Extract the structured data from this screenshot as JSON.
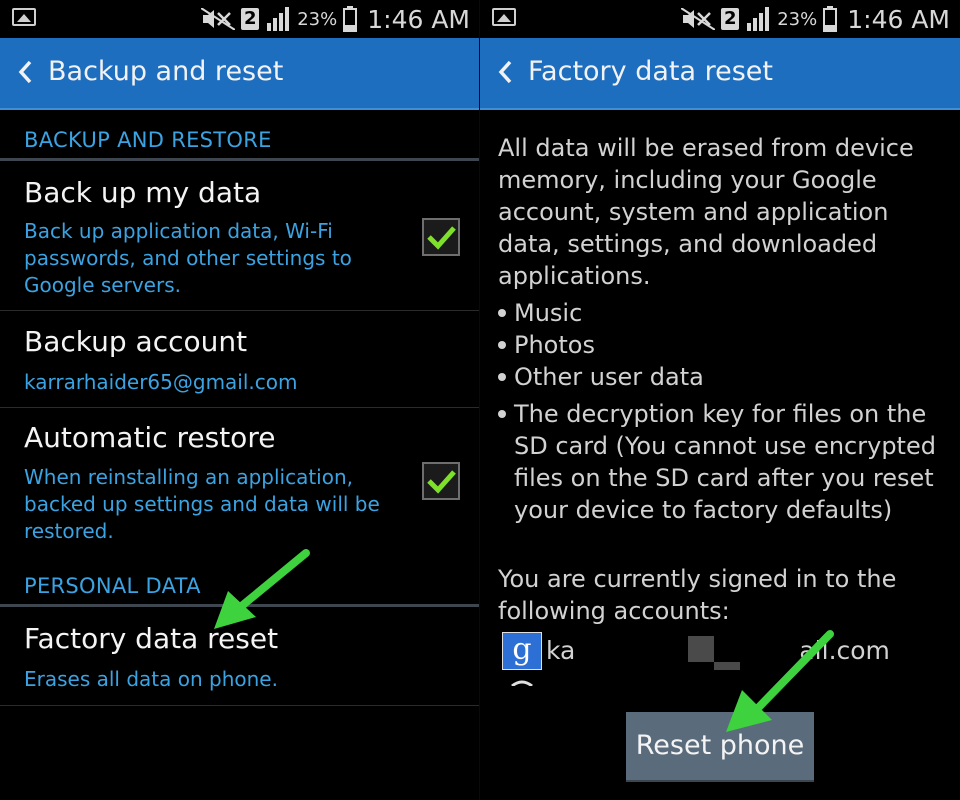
{
  "status_bar": {
    "sim_slot": "2",
    "battery_pct": "23%",
    "time": "1:46 AM",
    "icons": [
      "image-icon",
      "mute-icon",
      "sim-icon",
      "signal-icon",
      "battery-icon"
    ]
  },
  "left": {
    "title": "Backup and reset",
    "section1": "BACKUP AND RESTORE",
    "items": [
      {
        "title": "Back up my data",
        "subtitle": "Back up application data, Wi-Fi passwords, and other settings to Google servers.",
        "checked": true
      },
      {
        "title": "Backup account",
        "subtitle": "karrarhaider65@gmail.com"
      },
      {
        "title": "Automatic restore",
        "subtitle": "When reinstalling an application, backed up settings and data will be restored.",
        "checked": true
      }
    ],
    "section2": "PERSONAL DATA",
    "factory_item": {
      "title": "Factory data reset",
      "subtitle": "Erases all data on phone."
    }
  },
  "right": {
    "title": "Factory data reset",
    "intro": "All data will be erased from device memory, including your Google account, system and application data, settings, and downloaded applications.",
    "bullets": [
      "Music",
      "Photos",
      "Other user data",
      "The decryption key for files on the SD card (You cannot use encrypted files on the SD card after you reset your device to factory defaults)"
    ],
    "signed_in": "You are currently signed in to the following accounts:",
    "account_prefix": "ka",
    "account_suffix": "ail.com",
    "reset_button": "Reset phone"
  },
  "colors": {
    "action_bar": "#1e6ec0",
    "accent": "#3ba3e2",
    "check": "#7ee028",
    "arrow": "#3fd23f",
    "button": "#5a6b7c"
  }
}
